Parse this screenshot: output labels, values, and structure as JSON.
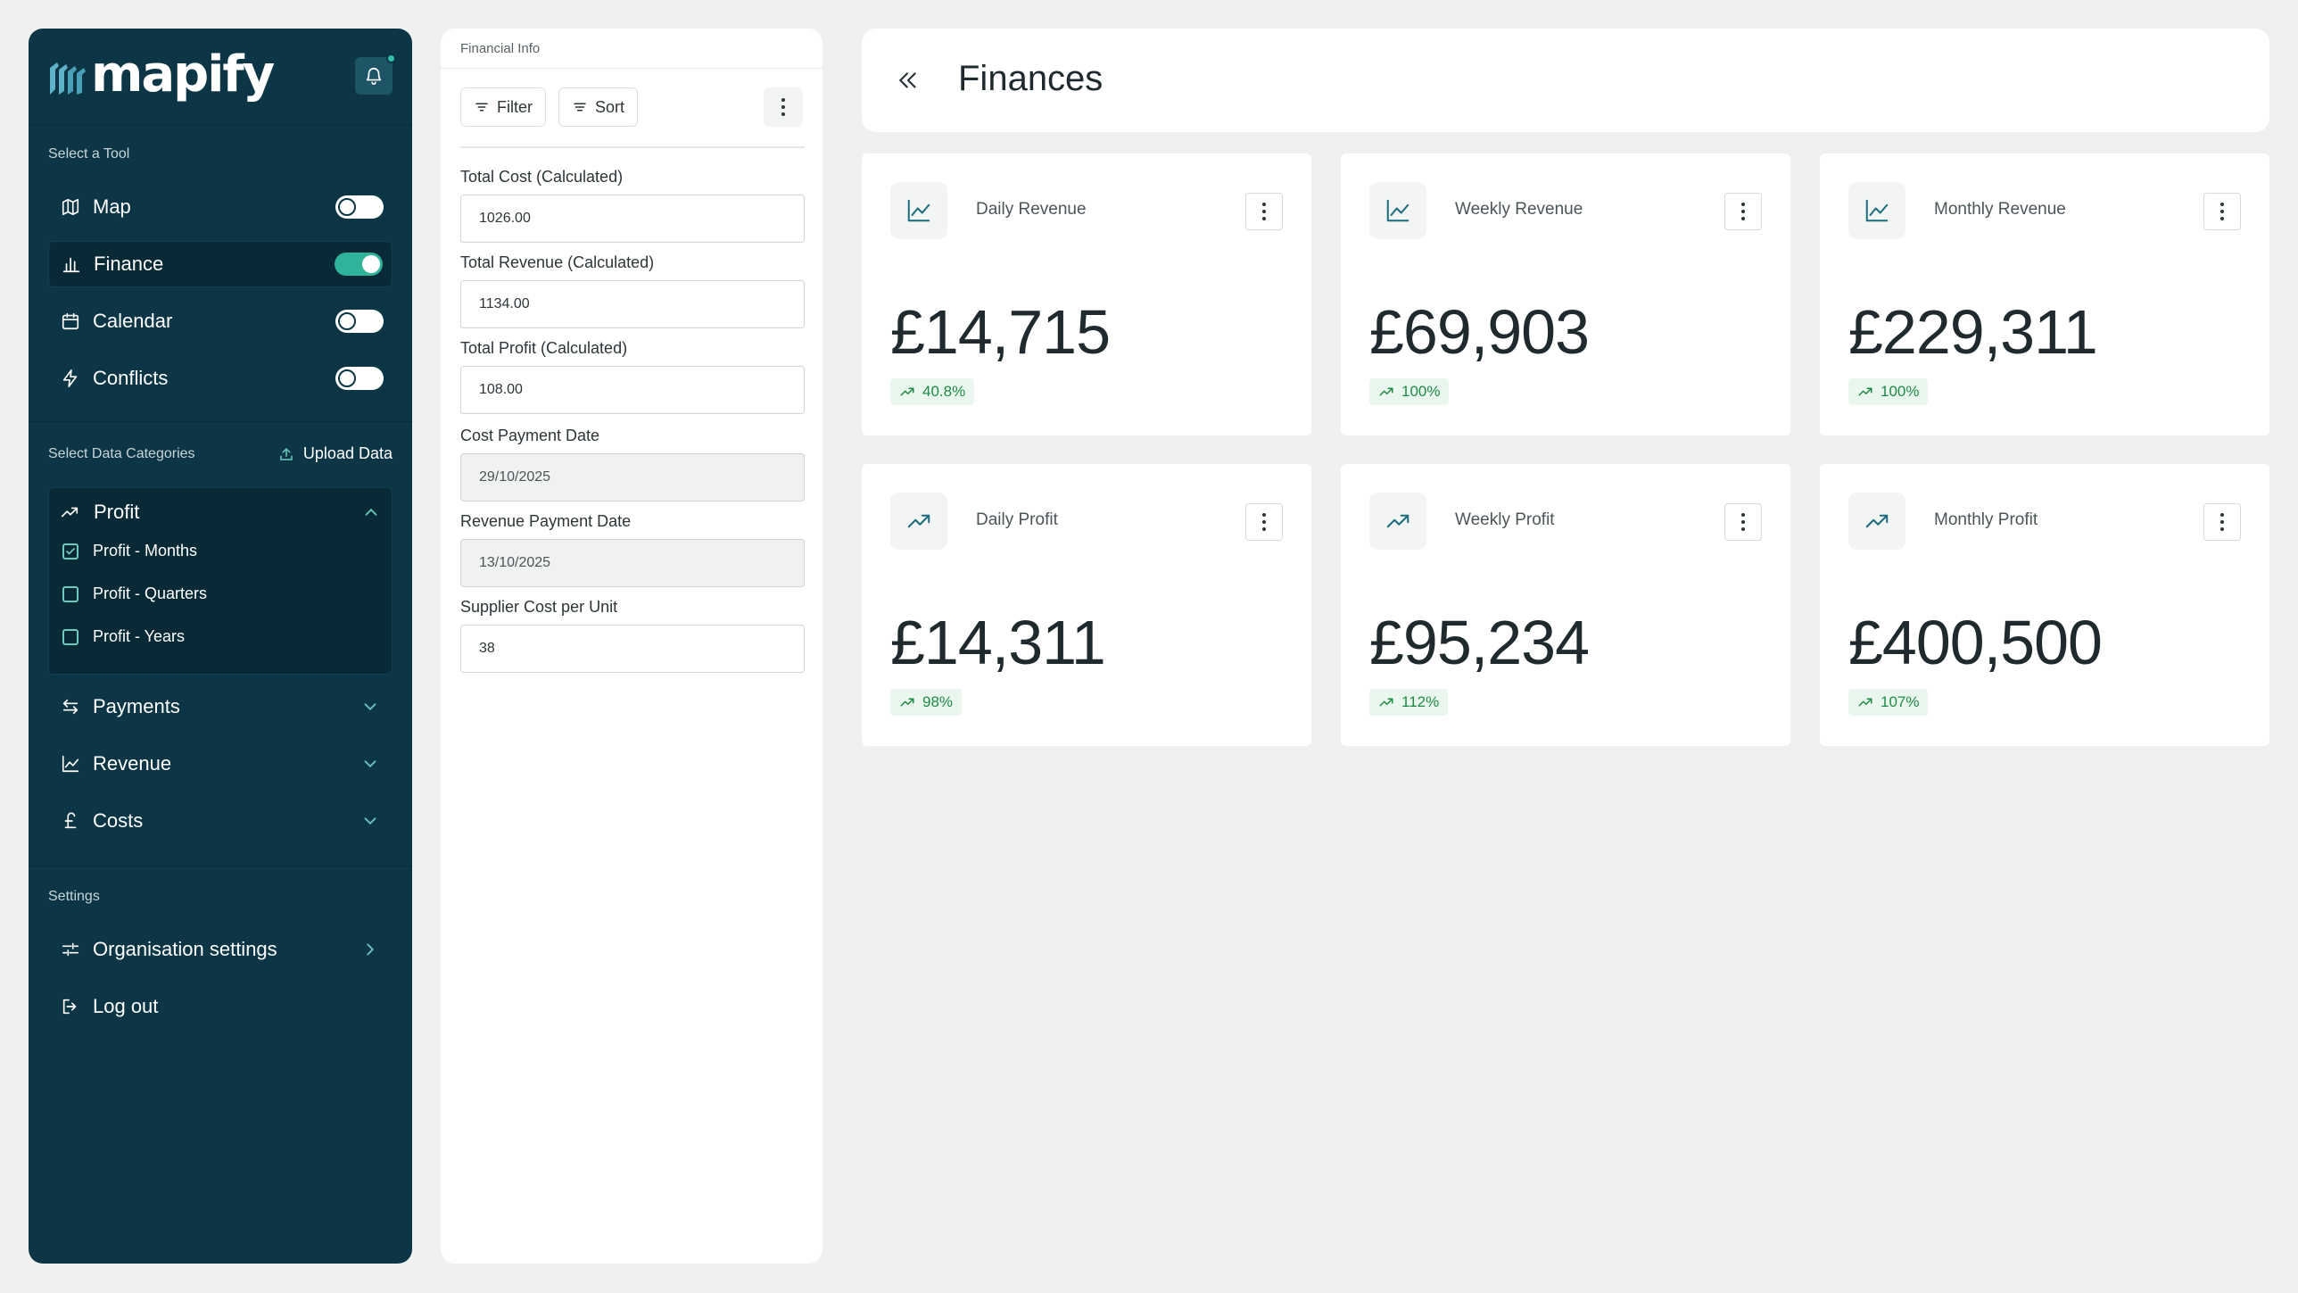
{
  "brand": {
    "name": "mapify"
  },
  "sidebar": {
    "tools_label": "Select a Tool",
    "tools": [
      {
        "label": "Map",
        "icon": "map-icon",
        "enabled": false
      },
      {
        "label": "Finance",
        "icon": "bar-chart-icon",
        "enabled": true
      },
      {
        "label": "Calendar",
        "icon": "calendar-icon",
        "enabled": false
      },
      {
        "label": "Conflicts",
        "icon": "lightning-icon",
        "enabled": false
      }
    ],
    "categories_label": "Select Data Categories",
    "upload_label": "Upload Data",
    "profit": {
      "label": "Profit",
      "options": [
        {
          "label": "Profit - Months",
          "checked": true
        },
        {
          "label": "Profit - Quarters",
          "checked": false
        },
        {
          "label": "Profit - Years",
          "checked": false
        }
      ]
    },
    "categories": [
      {
        "label": "Payments",
        "icon": "arrows-exchange-icon"
      },
      {
        "label": "Revenue",
        "icon": "line-chart-icon"
      },
      {
        "label": "Costs",
        "icon": "pound-icon"
      }
    ],
    "settings_label": "Settings",
    "org_settings_label": "Organisation settings",
    "logout_label": "Log out"
  },
  "panel": {
    "title": "Financial Info",
    "filter_label": "Filter",
    "sort_label": "Sort",
    "fields": [
      {
        "label": "Total Cost (Calculated)",
        "value": "1026.00",
        "disabled": false
      },
      {
        "label": "Total Revenue (Calculated)",
        "value": "1134.00",
        "disabled": false
      },
      {
        "label": "Total Profit (Calculated)",
        "value": "108.00",
        "disabled": false
      },
      {
        "label": "Cost Payment Date",
        "value": "29/10/2025",
        "disabled": true
      },
      {
        "label": "Revenue Payment Date",
        "value": "13/10/2025",
        "disabled": true
      },
      {
        "label": "Supplier Cost per Unit",
        "value": "38",
        "disabled": false
      }
    ]
  },
  "main": {
    "title": "Finances",
    "cards": [
      {
        "title": "Daily Revenue",
        "value": "£14,715",
        "change": "40.8%",
        "icon": "line-chart-icon"
      },
      {
        "title": "Weekly Revenue",
        "value": "£69,903",
        "change": "100%",
        "icon": "line-chart-icon"
      },
      {
        "title": "Monthly Revenue",
        "value": "£229,311",
        "change": "100%",
        "icon": "line-chart-icon"
      },
      {
        "title": "Daily Profit",
        "value": "£14,311",
        "change": "98%",
        "icon": "trending-up-icon"
      },
      {
        "title": "Weekly Profit",
        "value": "£95,234",
        "change": "112%",
        "icon": "trending-up-icon"
      },
      {
        "title": "Monthly Profit",
        "value": "£400,500",
        "change": "107%",
        "icon": "trending-up-icon"
      }
    ]
  },
  "colors": {
    "sidebar_bg": "#0c3646",
    "accent": "#2fb39b",
    "positive": "#1f8a45"
  }
}
